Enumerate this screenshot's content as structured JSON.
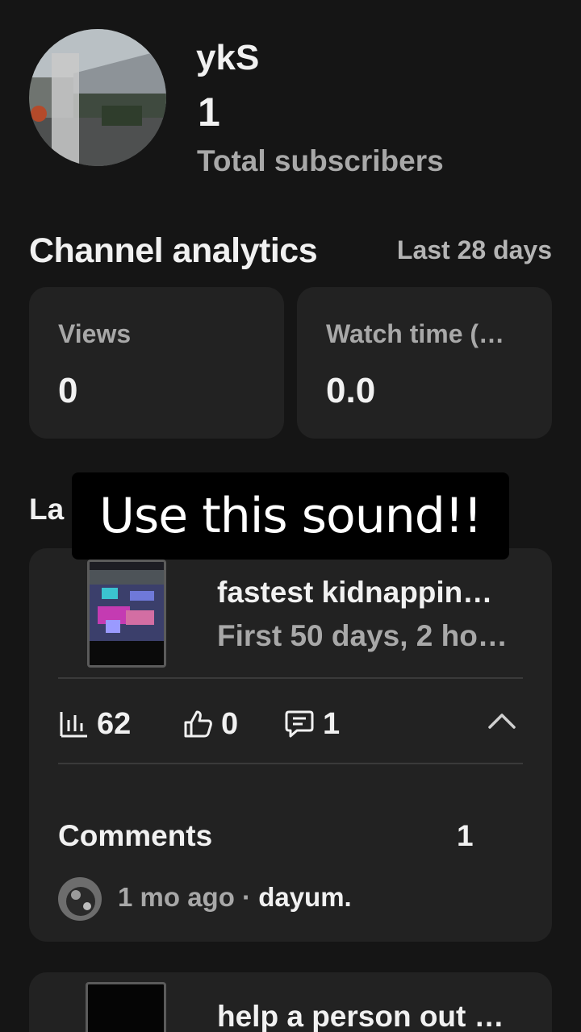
{
  "channel": {
    "name": "ykS",
    "subscribers": "1",
    "subscribers_label": "Total subscribers"
  },
  "analytics": {
    "title": "Channel analytics",
    "period": "Last 28 days",
    "cards": [
      {
        "label": "Views",
        "value": "0"
      },
      {
        "label": "Watch time (…",
        "value": "0.0"
      }
    ]
  },
  "latest": {
    "heading_visible": "La"
  },
  "overlay": {
    "caption": "Use this sound!!"
  },
  "video": {
    "title": "fastest kidnappin…",
    "subtitle": "First 50 days, 2 ho…",
    "views": "62",
    "likes": "0",
    "comments": "1",
    "comments_label": "Comments",
    "comments_count": "1",
    "comment": {
      "time": "1 mo ago",
      "separator": " · ",
      "text": "dayum."
    },
    "icons": {
      "views": "bar-chart-icon",
      "likes": "thumbs-up-icon",
      "comments": "comment-icon",
      "collapse": "chevron-up-icon"
    }
  },
  "video2": {
    "title": "help a person out …"
  },
  "colors": {
    "background": "#151515",
    "card": "#222222",
    "primary_text": "#f1f1f1",
    "secondary_text": "#a8a8a8"
  }
}
